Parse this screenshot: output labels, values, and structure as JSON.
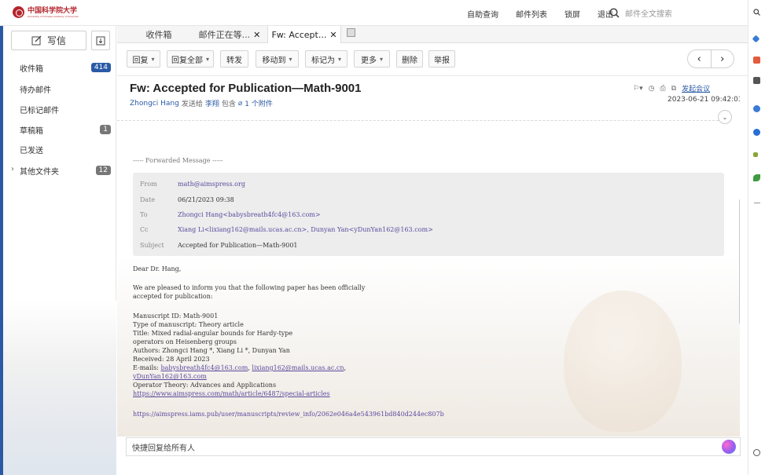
{
  "header": {
    "logo_cn": "中国科学院大学",
    "logo_en": "University of Chinese Academy of Sciences",
    "links": [
      "自助查询",
      "邮件列表",
      "锁屏",
      "退出"
    ],
    "search_placeholder": "邮件全文搜索"
  },
  "sidebar": {
    "write_label": "写信",
    "folders": [
      {
        "label": "收件箱",
        "count": "414",
        "highlight": true
      },
      {
        "label": "待办邮件",
        "count": ""
      },
      {
        "label": "已标记邮件",
        "count": ""
      },
      {
        "label": "草稿箱",
        "count": "1"
      },
      {
        "label": "已发送",
        "count": ""
      },
      {
        "label": "其他文件夹",
        "count": "12",
        "expandable": true
      }
    ]
  },
  "tabs": [
    {
      "label": "收件箱",
      "closable": false
    },
    {
      "label": "邮件正在等...",
      "closable": true
    },
    {
      "label": "Fw: Accept...",
      "closable": true,
      "active": true
    }
  ],
  "toolbar": {
    "buttons": [
      {
        "label": "回复",
        "dropdown": true
      },
      {
        "label": "回复全部",
        "dropdown": true
      },
      {
        "label": "转发",
        "dropdown": false
      },
      {
        "label": "移动到",
        "dropdown": true
      },
      {
        "label": "标记为",
        "dropdown": true
      },
      {
        "label": "更多",
        "dropdown": true
      },
      {
        "label": "删除",
        "dropdown": false
      },
      {
        "label": "举报",
        "dropdown": false
      }
    ],
    "prev": "‹",
    "next": "›"
  },
  "mail": {
    "subject": "Fw: Accepted for Publication—Math-9001",
    "sender": "Zhongci Hang",
    "sent_to_text": "发送给",
    "recipient": "李翔",
    "include_text": "包含",
    "attachment_text": "1 个附件",
    "meeting_link": "发起会议",
    "datetime": "2023-06-21 09:42:03",
    "forwarded_line": "----- Forwarded Message -----",
    "headers": [
      {
        "key": "From",
        "value": "math@aimspress.org",
        "link": true
      },
      {
        "key": "Date",
        "value": "06/21/2023 09:38",
        "link": false
      },
      {
        "key": "To",
        "value": "Zhongci Hang<babysbreath4fc4@163.com>",
        "link": true
      },
      {
        "key": "Cc",
        "value": "Xiang Li<lixiang162@mails.ucas.ac.cn>, Dunyan Yan<yDunYan162@163.com>",
        "link": true
      },
      {
        "key": "Subject",
        "value": "Accepted for Publication—Math-9001",
        "link": false
      }
    ],
    "greeting": "Dear Dr. Hang,",
    "para1_line1": "We are pleased to inform you that the following paper has been officially",
    "para1_line2": "accepted for publication:",
    "manuscript_id": "Manuscript ID: Math-9001",
    "type": "Type of manuscript: Theory article",
    "title_line1": "Title: Mixed radial-angular bounds for Hardy-type",
    "title_line2": "operators on Heisenberg groups",
    "authors": "Authors: Zhongci Hang *, Xiang Li *, Dunyan Yan",
    "received": "Received: 28 April 2023",
    "emails_prefix": "E-mails:",
    "email1": "babysbreath4fc4@163.com",
    "email2": "lixiang162@mails.ucas.ac.cn",
    "email3": "yDunYan162@163.com",
    "journal": "Operator Theory: Advances and Applications",
    "article_url": "https://www.aimspress.com/math/article/6487/special-articles",
    "review_url": "https://aimspress.iams.pub/user/manuscripts/review_info/2062e046a4e543961bd840d244ec807b"
  },
  "reply": {
    "placeholder": "快捷回复给所有人"
  }
}
